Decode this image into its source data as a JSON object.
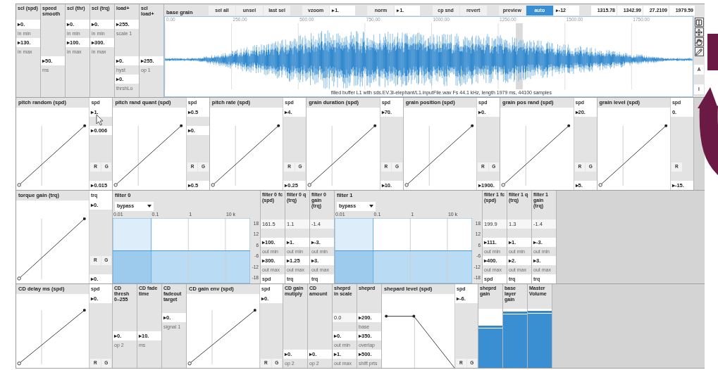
{
  "rows": [
    {
      "panels": [
        {
          "kind": "column",
          "title": "scl (spd)",
          "items": [
            {
              "kind": "field",
              "text": "▸0."
            },
            {
              "kind": "caption",
              "text": "in min"
            },
            {
              "kind": "field",
              "text": "▸130."
            },
            {
              "kind": "caption",
              "text": "in max"
            }
          ]
        },
        {
          "kind": "column",
          "title": "speed smooth",
          "items": [
            {
              "kind": "gap"
            },
            {
              "kind": "gap"
            },
            {
              "kind": "gap"
            },
            {
              "kind": "gap"
            },
            {
              "kind": "field",
              "text": "▸50."
            },
            {
              "kind": "caption",
              "text": "ms"
            }
          ]
        },
        {
          "kind": "column",
          "title": "scl (thr)",
          "items": [
            {
              "kind": "field",
              "text": "▸0."
            },
            {
              "kind": "caption",
              "text": "in min"
            },
            {
              "kind": "field",
              "text": "▸100."
            },
            {
              "kind": "caption",
              "text": "in max"
            }
          ]
        },
        {
          "kind": "column",
          "title": "scl (trq)",
          "items": [
            {
              "kind": "field",
              "text": "▸0."
            },
            {
              "kind": "caption",
              "text": "in min"
            },
            {
              "kind": "field",
              "text": "▸300."
            },
            {
              "kind": "caption",
              "text": "in max"
            }
          ]
        },
        {
          "kind": "column",
          "title": "load+",
          "items": [
            {
              "kind": "field",
              "text": "▸255."
            },
            {
              "kind": "caption",
              "text": "scale 1"
            },
            {
              "kind": "gap"
            },
            {
              "kind": "gap"
            },
            {
              "kind": "field",
              "text": "▸0."
            },
            {
              "kind": "caption",
              "text": "hyst"
            },
            {
              "kind": "field",
              "text": "▸0."
            },
            {
              "kind": "caption",
              "text": "thrshLo"
            }
          ]
        },
        {
          "kind": "column",
          "title": "scl load+",
          "items": [
            {
              "kind": "gap"
            },
            {
              "kind": "gap"
            },
            {
              "kind": "gap"
            },
            {
              "kind": "gap"
            },
            {
              "kind": "field",
              "text": "▸255."
            },
            {
              "kind": "caption",
              "text": "op 1"
            }
          ]
        },
        {
          "kind": "waveform",
          "title": "base grain",
          "toolbar": [
            {
              "kind": "button",
              "text": "sel all",
              "on": false
            },
            {
              "kind": "button",
              "text": "unsel",
              "on": false
            },
            {
              "kind": "button",
              "text": "last sel",
              "on": false
            },
            {
              "kind": "gap"
            },
            {
              "kind": "button",
              "text": "vzoom",
              "on": false
            },
            {
              "kind": "number",
              "text": "▸1."
            },
            {
              "kind": "gap"
            },
            {
              "kind": "button",
              "text": "norm",
              "on": false
            },
            {
              "kind": "number",
              "text": "▸1."
            },
            {
              "kind": "gap"
            },
            {
              "kind": "button",
              "text": "cp snd",
              "on": false
            },
            {
              "kind": "button",
              "text": "revert",
              "on": false
            },
            {
              "kind": "gap"
            },
            {
              "kind": "button",
              "text": "preview",
              "on": false
            },
            {
              "kind": "button",
              "text": "auto",
              "on": true
            },
            {
              "kind": "number",
              "text": "▸-12"
            },
            {
              "kind": "gap"
            },
            {
              "kind": "readout",
              "text": "1315.78"
            },
            {
              "kind": "readout",
              "text": "1342.99"
            },
            {
              "kind": "readout",
              "text": "27.2109"
            },
            {
              "kind": "readout",
              "text": "1979.59"
            }
          ],
          "ticks": [
            "0.00",
            "250.00",
            "500.00",
            "750.00",
            "1000.00",
            "1250.00",
            "1500.00",
            "1750.00"
          ],
          "caption": "filled buffer L1 with sds.EV.3l-elephant/L1.inputFile.wav Fs 44.1 kHz, length 1979 ms, 44100 samples",
          "side_buttons": [
            "A",
            "I"
          ]
        }
      ]
    },
    {
      "panels": [
        {
          "kind": "curve",
          "title": "pitch random (spd)",
          "side": [
            {
              "kind": "unit",
              "text": "spd"
            },
            {
              "kind": "field",
              "text": "▸1."
            },
            {
              "kind": "gap"
            },
            {
              "kind": "field",
              "text": "▸0.006"
            },
            {
              "kind": "fill"
            },
            {
              "kind": "rg",
              "labels": [
                "R",
                "G"
              ]
            },
            {
              "kind": "gap"
            },
            {
              "kind": "field",
              "text": "▸0.015"
            }
          ]
        },
        {
          "kind": "curve",
          "title": "pitch rand quant (spd)",
          "side": [
            {
              "kind": "unit",
              "text": "spd"
            },
            {
              "kind": "field",
              "text": "▸0.5"
            },
            {
              "kind": "gap"
            },
            {
              "kind": "field",
              "text": "▸0."
            },
            {
              "kind": "fill"
            },
            {
              "kind": "rg",
              "labels": [
                "R",
                "G"
              ]
            },
            {
              "kind": "gap"
            },
            {
              "kind": "field",
              "text": "▸0.5"
            }
          ]
        },
        {
          "kind": "curve",
          "title": "pitch rate (spd)",
          "side": [
            {
              "kind": "unit",
              "text": "spd"
            },
            {
              "kind": "field",
              "text": "▸4."
            },
            {
              "kind": "fill"
            },
            {
              "kind": "rg",
              "labels": [
                "R",
                "G"
              ]
            },
            {
              "kind": "gap"
            },
            {
              "kind": "field",
              "text": "▸0.25"
            }
          ]
        },
        {
          "kind": "curve",
          "title": "grain duration (spd)",
          "side": [
            {
              "kind": "unit",
              "text": "spd"
            },
            {
              "kind": "field",
              "text": "▸70."
            },
            {
              "kind": "fill"
            },
            {
              "kind": "rg",
              "labels": [
                "R",
                "G"
              ]
            },
            {
              "kind": "gap"
            },
            {
              "kind": "field",
              "text": "▸10."
            }
          ]
        },
        {
          "kind": "curve",
          "title": "grain position (spd)",
          "side": [
            {
              "kind": "unit",
              "text": "spd"
            },
            {
              "kind": "field",
              "text": "▸0."
            },
            {
              "kind": "fill"
            },
            {
              "kind": "rg",
              "labels": [
                "R",
                "G"
              ]
            },
            {
              "kind": "gap"
            },
            {
              "kind": "field",
              "text": "▸1900."
            }
          ]
        },
        {
          "kind": "curve",
          "title": "grain pos rand (spd)",
          "side": [
            {
              "kind": "unit",
              "text": "spd"
            },
            {
              "kind": "field",
              "text": "▸20."
            },
            {
              "kind": "fill"
            },
            {
              "kind": "rg",
              "labels": [
                "R",
                "G"
              ]
            },
            {
              "kind": "gap"
            },
            {
              "kind": "field",
              "text": "▸5."
            }
          ]
        },
        {
          "kind": "curve",
          "title": "grain level (spd)",
          "side": [
            {
              "kind": "unit",
              "text": "spd"
            },
            {
              "kind": "field",
              "text": "0."
            },
            {
              "kind": "fill"
            },
            {
              "kind": "rg",
              "labels": [
                "R"
              ]
            },
            {
              "kind": "gap"
            },
            {
              "kind": "field",
              "text": "▸-15."
            }
          ]
        }
      ]
    },
    {
      "panels": [
        {
          "kind": "curve",
          "title": "torque gain (trq)",
          "side": [
            {
              "kind": "unit",
              "text": "trq"
            },
            {
              "kind": "field",
              "text": "▸0."
            },
            {
              "kind": "fill"
            },
            {
              "kind": "rg",
              "labels": [
                "R",
                "G"
              ]
            },
            {
              "kind": "gap"
            },
            {
              "kind": "field",
              "text": "▸0."
            }
          ]
        },
        {
          "kind": "filter",
          "title": "filter 0",
          "mode": "bypass",
          "freq_labels": [
            "0.01",
            "0.1",
            "1",
            "10 k"
          ],
          "db_labels": [
            "18",
            "12",
            "6",
            "-6",
            "-12",
            "-18"
          ]
        },
        {
          "kind": "column",
          "title": "filter 0 fc (spd)",
          "items": [
            {
              "kind": "gap"
            },
            {
              "kind": "plain",
              "text": "161.5"
            },
            {
              "kind": "gap"
            },
            {
              "kind": "field",
              "text": "▸100."
            },
            {
              "kind": "caption",
              "text": "out min"
            },
            {
              "kind": "field",
              "text": "▸300."
            },
            {
              "kind": "caption",
              "text": "out max"
            },
            {
              "kind": "unit",
              "text": "spd"
            }
          ]
        },
        {
          "kind": "column",
          "title": "filter 0 q (trq)",
          "items": [
            {
              "kind": "gap"
            },
            {
              "kind": "plain",
              "text": "1.1"
            },
            {
              "kind": "gap"
            },
            {
              "kind": "field",
              "text": "▸1."
            },
            {
              "kind": "caption",
              "text": "out min"
            },
            {
              "kind": "field",
              "text": "▸1.25"
            },
            {
              "kind": "caption",
              "text": "out max"
            },
            {
              "kind": "unit",
              "text": "trq"
            }
          ]
        },
        {
          "kind": "column",
          "title": "filter 0 gain (trq)",
          "items": [
            {
              "kind": "gap"
            },
            {
              "kind": "plain",
              "text": "-1.4"
            },
            {
              "kind": "gap"
            },
            {
              "kind": "field",
              "text": "▸-3."
            },
            {
              "kind": "caption",
              "text": "out min"
            },
            {
              "kind": "field",
              "text": "▸3."
            },
            {
              "kind": "caption",
              "text": "out max"
            },
            {
              "kind": "unit",
              "text": "trq"
            }
          ]
        },
        {
          "kind": "filter",
          "title": "filter 1",
          "mode": "bypass",
          "freq_labels": [
            "0.01",
            "0.1",
            "1",
            "10 k"
          ],
          "db_labels": [
            "18",
            "12",
            "6",
            "-6",
            "-12",
            "-18"
          ]
        },
        {
          "kind": "column",
          "title": "filter 1 fc (spd)",
          "items": [
            {
              "kind": "gap"
            },
            {
              "kind": "plain",
              "text": "199.9"
            },
            {
              "kind": "gap"
            },
            {
              "kind": "field",
              "text": "▸111."
            },
            {
              "kind": "caption",
              "text": "out min"
            },
            {
              "kind": "field",
              "text": "▸400."
            },
            {
              "kind": "caption",
              "text": "out max"
            },
            {
              "kind": "unit",
              "text": "spd"
            }
          ]
        },
        {
          "kind": "column",
          "title": "filter 1 q (trq)",
          "items": [
            {
              "kind": "gap"
            },
            {
              "kind": "plain",
              "text": "1.3"
            },
            {
              "kind": "gap"
            },
            {
              "kind": "field",
              "text": "▸1."
            },
            {
              "kind": "caption",
              "text": "out min"
            },
            {
              "kind": "field",
              "text": "▸2."
            },
            {
              "kind": "caption",
              "text": "out max"
            },
            {
              "kind": "unit",
              "text": "trq"
            }
          ]
        },
        {
          "kind": "column",
          "title": "filter 1 gain (trq)",
          "items": [
            {
              "kind": "gap"
            },
            {
              "kind": "plain",
              "text": "-1.4"
            },
            {
              "kind": "gap"
            },
            {
              "kind": "field",
              "text": "▸-3."
            },
            {
              "kind": "caption",
              "text": "out min"
            },
            {
              "kind": "field",
              "text": "▸3."
            },
            {
              "kind": "caption",
              "text": "out max"
            },
            {
              "kind": "unit",
              "text": "trq"
            }
          ]
        }
      ]
    },
    {
      "panels": [
        {
          "kind": "curve",
          "title": "CD delay ms (spd)",
          "side": [
            {
              "kind": "unit",
              "text": "spd"
            },
            {
              "kind": "field",
              "text": "▸0."
            },
            {
              "kind": "fill"
            },
            {
              "kind": "rg",
              "labels": [
                "R",
                "G"
              ]
            }
          ]
        },
        {
          "kind": "column",
          "title": "CD thresh 0–255",
          "items": [
            {
              "kind": "gap"
            },
            {
              "kind": "gap"
            },
            {
              "kind": "gap"
            },
            {
              "kind": "field",
              "text": "▸0."
            },
            {
              "kind": "caption",
              "text": "op 2"
            }
          ]
        },
        {
          "kind": "column",
          "title": "CD fade time",
          "items": [
            {
              "kind": "gap"
            },
            {
              "kind": "gap"
            },
            {
              "kind": "gap"
            },
            {
              "kind": "field",
              "text": "▸10."
            },
            {
              "kind": "caption",
              "text": "ms"
            }
          ]
        },
        {
          "kind": "column",
          "title": "CD fadeout target",
          "items": [
            {
              "kind": "gap"
            },
            {
              "kind": "field",
              "text": "▸0."
            },
            {
              "kind": "caption",
              "text": "signal 1"
            }
          ]
        },
        {
          "kind": "curve",
          "title": "CD gain env (spd)",
          "side": [
            {
              "kind": "unit",
              "text": "spd"
            },
            {
              "kind": "field",
              "text": "▸0."
            },
            {
              "kind": "fill"
            },
            {
              "kind": "rg",
              "labels": [
                "R",
                "G"
              ]
            }
          ]
        },
        {
          "kind": "column",
          "title": "CD gain mutiply",
          "items": [
            {
              "kind": "gap"
            },
            {
              "kind": "gap"
            },
            {
              "kind": "gap"
            },
            {
              "kind": "gap"
            },
            {
              "kind": "gap"
            },
            {
              "kind": "field",
              "text": "▸0."
            },
            {
              "kind": "caption",
              "text": "op 2"
            }
          ]
        },
        {
          "kind": "column",
          "title": "CD amount",
          "items": [
            {
              "kind": "gap"
            },
            {
              "kind": "gap"
            },
            {
              "kind": "gap"
            },
            {
              "kind": "gap"
            },
            {
              "kind": "gap"
            },
            {
              "kind": "field",
              "text": "▸0."
            },
            {
              "kind": "caption",
              "text": "op 2"
            }
          ]
        },
        {
          "kind": "column",
          "title": "sheprd in scale",
          "items": [
            {
              "kind": "gap"
            },
            {
              "kind": "plain",
              "text": "0.0"
            },
            {
              "kind": "gap"
            },
            {
              "kind": "field",
              "text": "▸0."
            },
            {
              "kind": "caption",
              "text": "out min"
            },
            {
              "kind": "field",
              "text": "▸1."
            },
            {
              "kind": "caption",
              "text": "out max"
            }
          ]
        },
        {
          "kind": "column",
          "title": "sheprd",
          "items": [
            {
              "kind": "gap"
            },
            {
              "kind": "field",
              "text": "▸200."
            },
            {
              "kind": "caption",
              "text": "base"
            },
            {
              "kind": "field",
              "text": "▸350."
            },
            {
              "kind": "caption",
              "text": "overlap"
            },
            {
              "kind": "field",
              "text": "▸500."
            },
            {
              "kind": "caption",
              "text": "shift prts"
            }
          ]
        },
        {
          "kind": "fall_curve",
          "title": "shepard level (spd)",
          "side": [
            {
              "kind": "unit",
              "text": "spd"
            },
            {
              "kind": "field",
              "text": "▸-6."
            },
            {
              "kind": "fill"
            },
            {
              "kind": "rg",
              "labels": [
                "R",
                "G"
              ]
            }
          ]
        },
        {
          "kind": "meter",
          "title": "sheprd gain"
        },
        {
          "kind": "meter",
          "title": "base layer gain"
        },
        {
          "kind": "meter",
          "title": "Master Volume"
        }
      ]
    }
  ]
}
